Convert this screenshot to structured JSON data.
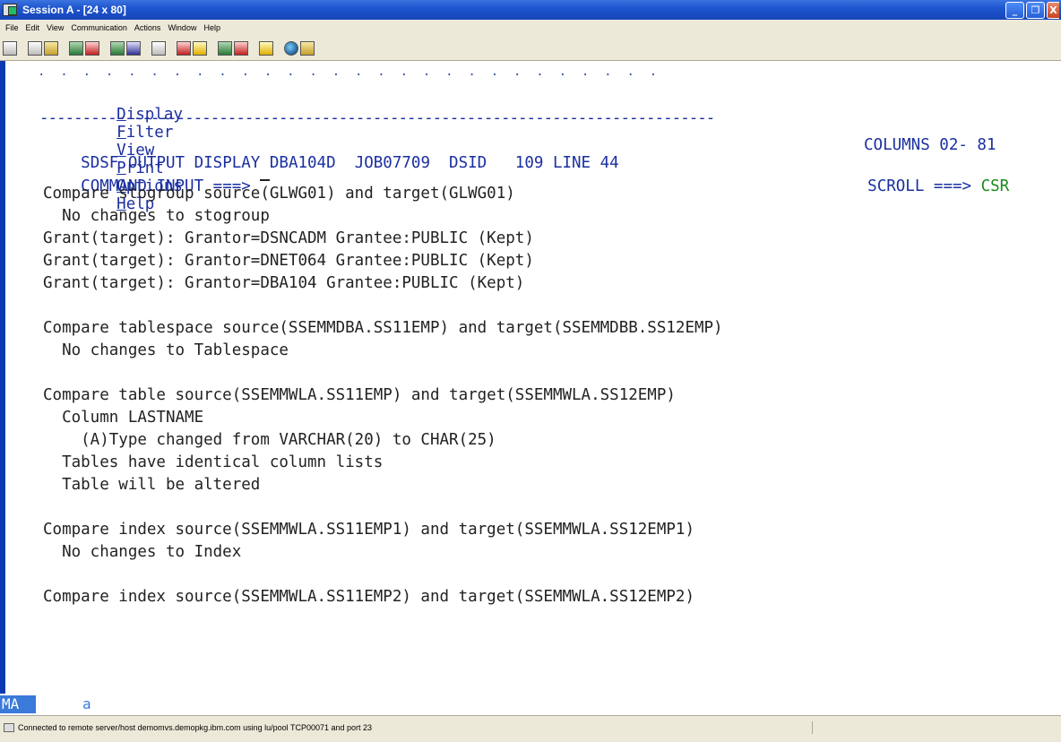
{
  "window": {
    "title": "Session A - [24 x 80]",
    "minimize_glyph": "_",
    "restore_glyph": "❐",
    "close_glyph": "X"
  },
  "menubar": {
    "items": [
      "File",
      "Edit",
      "View",
      "Communication",
      "Actions",
      "Window",
      "Help"
    ]
  },
  "toolbar": {
    "buttons": [
      "print-screen",
      "copy",
      "paste",
      "send",
      "receive",
      "display",
      "color",
      "settings",
      "record",
      "playback",
      "macro-run",
      "macro-stop",
      "clipboard",
      "globe",
      "edit-tool"
    ]
  },
  "terminal": {
    "dots": ".  .  .  .  .  .  .  .  .  .  .  .  .  .  .  .  .  .  .  .  .  .  .  .  .  .  .  .",
    "menu": [
      {
        "hot": "D",
        "rest": "isplay"
      },
      {
        "hot": "F",
        "rest": "ilter"
      },
      {
        "hot": "V",
        "rest": "iew"
      },
      {
        "hot": "P",
        "rest": "rint"
      },
      {
        "hot": "O",
        "rest": "ptions"
      },
      {
        "hot": "H",
        "rest": "elp"
      }
    ],
    "separator": "-------------------------------------------------------------------------------",
    "header1_left": "SDSF OUTPUT DISPLAY DBA104D  JOB07709  DSID   109 LINE 44",
    "header1_right": "COLUMNS 02- 81",
    "command_label": "COMMAND INPUT ===>",
    "command_value": "",
    "scroll_label": "SCROLL ===>",
    "scroll_value": "CSR",
    "output_lines": [
      "Compare stogroup source(GLWG01) and target(GLWG01)",
      "  No changes to stogroup",
      "Grant(target): Grantor=DSNCADM Grantee:PUBLIC (Kept)",
      "Grant(target): Grantor=DNET064 Grantee:PUBLIC (Kept)",
      "Grant(target): Grantor=DBA104 Grantee:PUBLIC (Kept)",
      "",
      "Compare tablespace source(SSEMMDBA.SS11EMP) and target(SSEMMDBB.SS12EMP)",
      "  No changes to Tablespace",
      "",
      "Compare table source(SSEMMWLA.SS11EMP) and target(SSEMMWLA.SS12EMP)",
      "  Column LASTNAME",
      "    (A)Type changed from VARCHAR(20) to CHAR(25)",
      "  Tables have identical column lists",
      "  Table will be altered",
      "",
      "Compare index source(SSEMMWLA.SS11EMP1) and target(SSEMMWLA.SS12EMP1)",
      "  No changes to Index",
      "",
      "Compare index source(SSEMMWLA.SS11EMP2) and target(SSEMMWLA.SS12EMP2)"
    ]
  },
  "oia": {
    "indicator": "MA",
    "session": "a"
  },
  "statusbar": {
    "text": "Connected to remote server/host demomvs.demopkg.ibm.com using lu/pool TCP00071 and port 23"
  }
}
